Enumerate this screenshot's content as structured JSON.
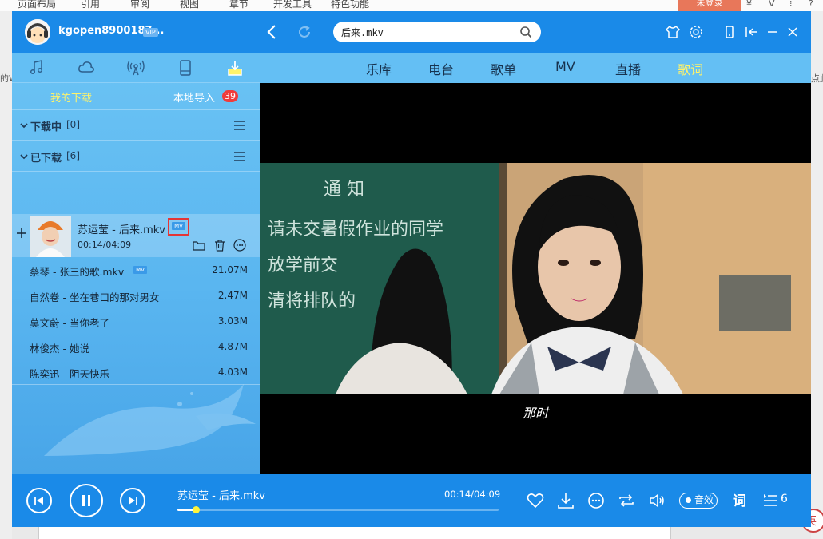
{
  "word": {
    "menus": [
      "页面布局",
      "引用",
      "审阅",
      "视图",
      "章节",
      "开发工具",
      "特色功能"
    ],
    "login_label": "未登录",
    "left_edge_text": "的W",
    "right_edge_text": "点此"
  },
  "header": {
    "username": "kgopen8900187...",
    "vip": "VIP",
    "search_value": "后来.mkv"
  },
  "sidebar": {
    "tabs": [
      "music-icon",
      "cloud-icon",
      "radio-icon",
      "device-icon",
      "download-icon"
    ],
    "subtabs": {
      "my_downloads": "我的下载",
      "local_import": "本地导入",
      "import_badge": "39"
    },
    "downloading": {
      "title": "下载中",
      "count": "[0]"
    },
    "downloaded": {
      "title": "已下载",
      "count": "[6]"
    },
    "active": {
      "title": "苏运莹 - 后来.mkv",
      "badge": "MV",
      "time": "00:14/04:09"
    },
    "items": [
      {
        "title": "蔡琴 - 张三的歌.mkv",
        "badge": "MV",
        "size": "21.07M"
      },
      {
        "title": "自然卷 - 坐在巷口的那对男女",
        "badge": "",
        "size": "2.47M"
      },
      {
        "title": "莫文蔚 - 当你老了",
        "badge": "",
        "size": "3.03M"
      },
      {
        "title": "林俊杰 - 她说",
        "badge": "",
        "size": "4.87M"
      },
      {
        "title": "陈奕迅 - 阴天快乐",
        "badge": "",
        "size": "4.03M"
      }
    ]
  },
  "nav": {
    "tabs": [
      "乐库",
      "电台",
      "歌单",
      "MV",
      "直播",
      "歌词"
    ],
    "active_tab": "歌词",
    "active_color": "#fff36a"
  },
  "video": {
    "chalkboard_lines": [
      "通 知",
      "请未交暑假作业的同学",
      "放学前交",
      "清将排队的"
    ],
    "subtitle": "那时"
  },
  "player": {
    "title": "苏运莹 - 后来.mkv",
    "time": "00:14/04:09",
    "progress": 0.056,
    "effect": "音效",
    "lyric": "词",
    "queue_count": "6"
  },
  "colors": {
    "brand": "#1a8ae8",
    "sidebar": "#64bff4",
    "accent": "#fff36a",
    "badge_red": "#f03b3b"
  }
}
